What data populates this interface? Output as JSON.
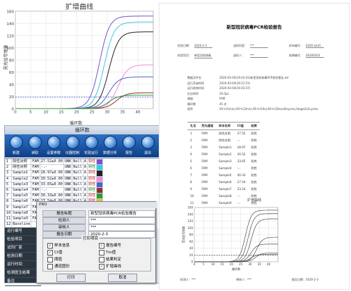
{
  "amplification_chart": {
    "title": "扩增曲线",
    "y_label": "荧光信号增量",
    "x_label": "循环数",
    "chart_data": {
      "type": "line",
      "x": [
        0,
        5,
        10,
        15,
        20,
        25,
        30,
        35,
        40,
        45
      ],
      "xlim": [
        0,
        45
      ],
      "ylim": [
        0,
        160
      ],
      "x_ticks": [
        "0",
        "5",
        "10",
        "15",
        "20",
        "25",
        "30",
        "35",
        "40"
      ],
      "y_ticks": [
        "0",
        "20",
        "40",
        "60",
        "80",
        "100",
        "120",
        "140",
        "160"
      ],
      "threshold": 19,
      "series": [
        {
          "color": "#7b4fd1",
          "ct": 27.5,
          "plateau": 152
        },
        {
          "color": "#39c9e6",
          "ct": 29.0,
          "plateau": 142
        },
        {
          "color": "#222222",
          "ct": 30.5,
          "plateau": 126
        },
        {
          "color": "#f18ad9",
          "ct": 33.5,
          "plateau": 72
        },
        {
          "color": "#4a66c9",
          "ct": 30.5,
          "plateau": 52
        },
        {
          "color": "#8a2f2f",
          "ct": 33.0,
          "plateau": 26
        },
        {
          "color": "#2a9a3a",
          "ct": 30.5,
          "plateau": 22
        }
      ],
      "threshold_color": "#3a5fd0"
    }
  },
  "software": {
    "window_title": "循环数",
    "toolbar": [
      {
        "label": "新建",
        "icon": "new-file-icon"
      },
      {
        "label": "读取",
        "icon": "open-icon"
      },
      {
        "label": "设置参数",
        "icon": "settings-icon"
      },
      {
        "label": "仪器控制",
        "icon": "instrument-icon"
      },
      {
        "label": "实验运行",
        "icon": "run-icon"
      },
      {
        "label": "数据分析",
        "icon": "analysis-icon"
      },
      {
        "label": "报告",
        "icon": "report-icon"
      },
      {
        "label": "退出",
        "icon": "exit-icon"
      }
    ],
    "rows": [
      [
        "1",
        "阳性对照",
        "FAM",
        "27.52±0.00",
        "UNK",
        "Null",
        "A",
        "阳性",
        "#7b4fd1"
      ],
      [
        "2",
        "阴性对照",
        "FAM",
        "-.-",
        "UNK",
        "Null",
        "A",
        "阴性",
        "#39c9e6"
      ],
      [
        "3",
        "Sample1",
        "FAM",
        "28.97±0.00",
        "UNK",
        "Null",
        "A",
        "阳性",
        "#222222"
      ],
      [
        "4",
        "Sample2",
        "FAM",
        "30.52±0.00",
        "UNK",
        "Null",
        "A",
        "阳性",
        "#f18ad9"
      ],
      [
        "5",
        "Sample3",
        "FAM",
        "33.65±0.00",
        "UNK",
        "Null",
        "A",
        "阳性",
        "#4a66c9"
      ],
      [
        "6",
        "Sample4",
        "FAM",
        "-.-",
        "UNK",
        "Null",
        "A",
        "阴性",
        "#8a2f2f"
      ],
      [
        "7",
        "Sample5",
        "FAM",
        "30.33±0.00",
        "UNK",
        "Null",
        "A",
        "阳性",
        "#2a9a3a"
      ],
      [
        "8",
        "Sample6",
        "FAM",
        "27.54±0.00",
        "UNK",
        "Null",
        "A",
        "阳性",
        "#e6c020"
      ],
      [
        "9",
        "Sample7",
        "FAM",
        "33.24±0.00",
        "UNK",
        "Null",
        "A",
        "阳性",
        "#1a1a8a"
      ],
      [
        "10",
        "Sample8",
        "FAM",
        "-.-",
        "UNK",
        "Null",
        "A",
        "阴性",
        "#c02020"
      ],
      [
        "11",
        "Sample9",
        "FAM",
        "-.-",
        "UNK",
        "Null",
        "A",
        "阴性",
        "#cfcfcf"
      ],
      [
        "12",
        "Baseline",
        "",
        "",
        "",
        "",
        "",
        "",
        ""
      ]
    ],
    "nav": [
      "运行编号",
      "检验项目",
      "试剂厂家",
      "检测日期",
      "运行时间",
      "检测医生结果",
      "备注"
    ]
  },
  "dialog": {
    "title": "PRO",
    "report_title_label": "报告标题",
    "report_title_value": "新型冠状病毒PCR检验报告",
    "inspector_label": "检测人",
    "inspector_value": "***",
    "reviewer_label": "审核人",
    "reviewer_value": "***",
    "report_date_label": "报告日期",
    "report_date_value": "2020-2-3",
    "print_options_title": "打印项目",
    "options": [
      {
        "label": "样本信息",
        "checked": true
      },
      {
        "label": "报告编号",
        "checked": true
      },
      {
        "label": "Ct值",
        "checked": true
      },
      {
        "label": "Tm值",
        "checked": false
      },
      {
        "label": "阈值",
        "checked": false
      },
      {
        "label": "结果判定",
        "checked": false
      },
      {
        "label": "通道图形",
        "checked": false
      },
      {
        "label": "扩增曲线",
        "checked": true
      }
    ],
    "print_button": "打印",
    "cancel_button": "取消"
  },
  "report": {
    "title": "新型冠状病毒PCR检验报告",
    "top_fields": [
      {
        "label": "检验日期：",
        "value": "2020-2-3"
      },
      {
        "label": "送检科室：",
        "value": "***"
      },
      {
        "label": "样本编号：",
        "value": "2020-a2e5"
      },
      {
        "label": "检验项目：",
        "value": "新型冠状病毒"
      },
      {
        "label": "送检人：",
        "value": "***"
      },
      {
        "label": "结果编号：",
        "value": "20200203"
      }
    ],
    "details": [
      {
        "label": "数据文件名",
        "value": "2020-03-04(16:43:41)新型冠状病毒PCR检验报告.ezr"
      },
      {
        "label": "运行开始时间",
        "value": "2020-03-04(16:21:51)"
      },
      {
        "label": "运行结束时间",
        "value": "2020-03-04(16:43:37)"
      },
      {
        "label": "反应体积",
        "value": "20.0μL"
      },
      {
        "label": "通道",
        "value": "FAM"
      },
      {
        "label": "循环数",
        "value": "45 次"
      },
      {
        "label": "程序",
        "value": "50℃(5min),95℃(3min),95℃(10s),60℃(30s)x40cycles,Stage2x2cycles"
      }
    ],
    "table_headers": [
      "孔位",
      "荧光通道",
      "样本名称",
      "Ct值",
      "结果"
    ],
    "table_rows": [
      [
        "1",
        "FAM",
        "阳性对照",
        "27.52",
        "阳性"
      ],
      [
        "2",
        "FAM",
        "阴性对照",
        "-.-",
        "阴性"
      ],
      [
        "3",
        "FAM",
        "Sample1",
        "28.97",
        "阳性"
      ],
      [
        "4",
        "FAM",
        "Sample2",
        "30.52",
        "阳性"
      ],
      [
        "5",
        "FAM",
        "Sample3",
        "33.65",
        "阳性"
      ],
      [
        "6",
        "FAM",
        "Sample4",
        "-.-",
        "阴性"
      ],
      [
        "7",
        "FAM",
        "Sample5",
        "30.33",
        "阳性"
      ],
      [
        "8",
        "FAM",
        "Sample6",
        "27.54",
        "阳性"
      ],
      [
        "9",
        "FAM",
        "Sample7",
        "33.24",
        "阳性"
      ],
      [
        "10",
        "FAM",
        "Sample8",
        "-.-",
        "阴性"
      ],
      [
        "11",
        "FAM",
        "Sample9",
        "-.-",
        "阴性"
      ]
    ],
    "chart_title": "扩增曲线",
    "chart_x_label": "循环数",
    "chart_y_label": "荧光信号增量",
    "chart_x_ticks": [
      "0",
      "5",
      "10",
      "15",
      "20",
      "25",
      "30",
      "35",
      "40"
    ],
    "chart_y_ticks": [
      "0",
      "20",
      "40",
      "60",
      "80",
      "100",
      "120",
      "140",
      "160"
    ],
    "footer_inspector": "检测人：***",
    "footer_reviewer": "审核人：***",
    "footer_date": "报告日期：2020-2-3"
  }
}
